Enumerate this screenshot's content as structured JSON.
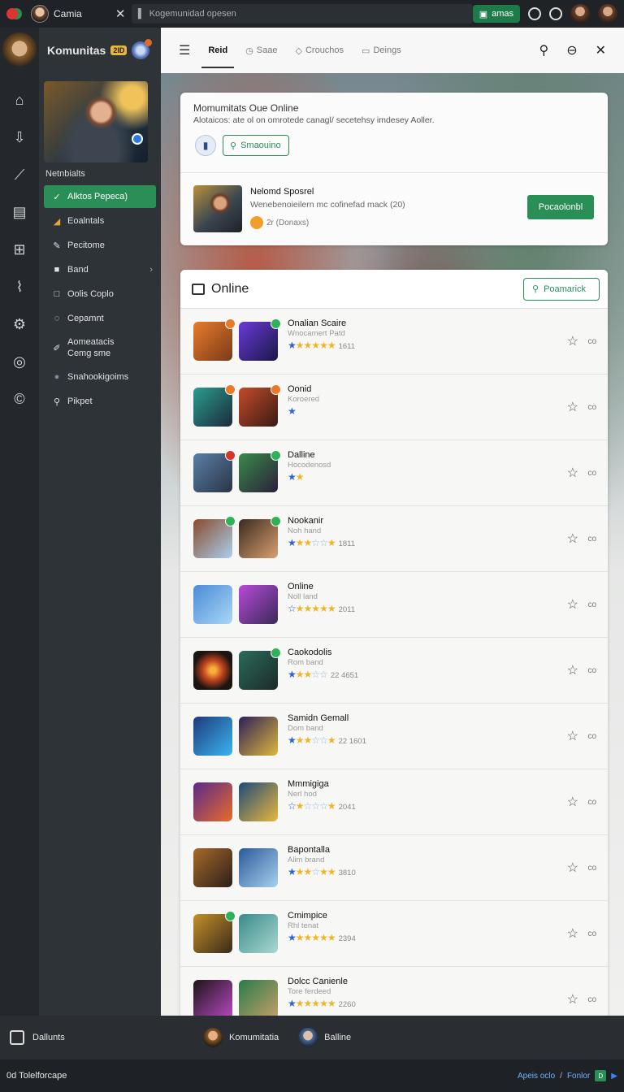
{
  "topbar": {
    "app_name": "Camia",
    "search_placeholder": "Kogemunidad opesen",
    "green_button": "amas"
  },
  "sidebar": {
    "title": "Komunitas",
    "badge": "2ID",
    "section_label": "Netnbialts",
    "items": [
      {
        "label": "Alktos Pepeca)",
        "icon": "✓"
      },
      {
        "label": "Eoalntals",
        "icon": "◢"
      },
      {
        "label": "Pecitome",
        "icon": "✎"
      },
      {
        "label": "Band",
        "icon": "■"
      },
      {
        "label": "Oolis Coplo",
        "icon": "□"
      },
      {
        "label": "Cepamnt",
        "icon": "◌"
      },
      {
        "label": "Aomeatacis Cemg sme",
        "icon": "✐"
      },
      {
        "label": "Snahookigoims",
        "icon": "●"
      },
      {
        "label": "Pikpet",
        "icon": "⚲"
      }
    ]
  },
  "tabs": {
    "items": [
      {
        "label": "Reid",
        "active": true
      },
      {
        "label": "Saae",
        "active": false
      },
      {
        "label": "Crouchos",
        "active": false
      },
      {
        "label": "Deings",
        "active": false
      }
    ]
  },
  "card1": {
    "title": "Momumitats Oue Online",
    "description": "Alotaicos: ate ol on omrotede canagl/ secetehsy imdesey Aoller.",
    "button_label": "Smaouino",
    "item_name": "Nelomd Sposrel",
    "item_sub": "Wenebenoieilern mc cofinefad mack (20)",
    "item_meta": "2r (Donaxs)",
    "cta_label": "Pocaolonbl"
  },
  "online": {
    "title": "Online",
    "button_label": "Poamarick",
    "rows": [
      {
        "name": "Onalian Scaire",
        "sub": "Wnocamert Patd",
        "stars": "★★★★★★",
        "count": "1611",
        "co": "co"
      },
      {
        "name": "Oonid",
        "sub": "Koroered",
        "stars": "★",
        "count": "",
        "co": "co"
      },
      {
        "name": "Dalline",
        "sub": "Hocodenosd",
        "stars": "★★",
        "count": "",
        "co": "co"
      },
      {
        "name": "Nookanir",
        "sub": "Noh hand",
        "stars": "★★★☆☆★",
        "count": "1811",
        "co": "co"
      },
      {
        "name": "Online",
        "sub": "Noll land",
        "stars": "☆★★★★★",
        "count": "2011",
        "co": "co"
      },
      {
        "name": "Caokodolis",
        "sub": "Rom band",
        "stars": "★★★☆☆",
        "count": "22 4651",
        "co": "co"
      },
      {
        "name": "Samidn Gemall",
        "sub": "Dom band",
        "stars": "★★★☆☆★",
        "count": "22 1601",
        "co": "co"
      },
      {
        "name": "Mmmigiga",
        "sub": "Nerl hod",
        "stars": "☆★☆☆☆★",
        "count": "2041",
        "co": "co"
      },
      {
        "name": "Bapontalla",
        "sub": "Alim brand",
        "stars": "★★★☆★★",
        "count": "3810",
        "co": "co"
      },
      {
        "name": "Cmimpice",
        "sub": "Rhl tenat",
        "stars": "★★★★★★",
        "count": "2394",
        "co": "co"
      },
      {
        "name": "Dolcc Canienle",
        "sub": "Tore ferdeed",
        "stars": "★★★★★★",
        "count": "2260",
        "co": "co"
      }
    ]
  },
  "bottombar": {
    "left_label": "Dallunts",
    "user1": "Komumitatia",
    "user2": "Balline"
  },
  "statusbar": {
    "left": "0d Tolelforcape",
    "right1": "Apeis oclo",
    "right2": "Fonlor",
    "box": "D"
  },
  "colors": {
    "accent_green": "#2a8f57",
    "sidebar_bg": "#2e3338",
    "star_gold": "#f0b429",
    "star_blue": "#2f63c9"
  }
}
